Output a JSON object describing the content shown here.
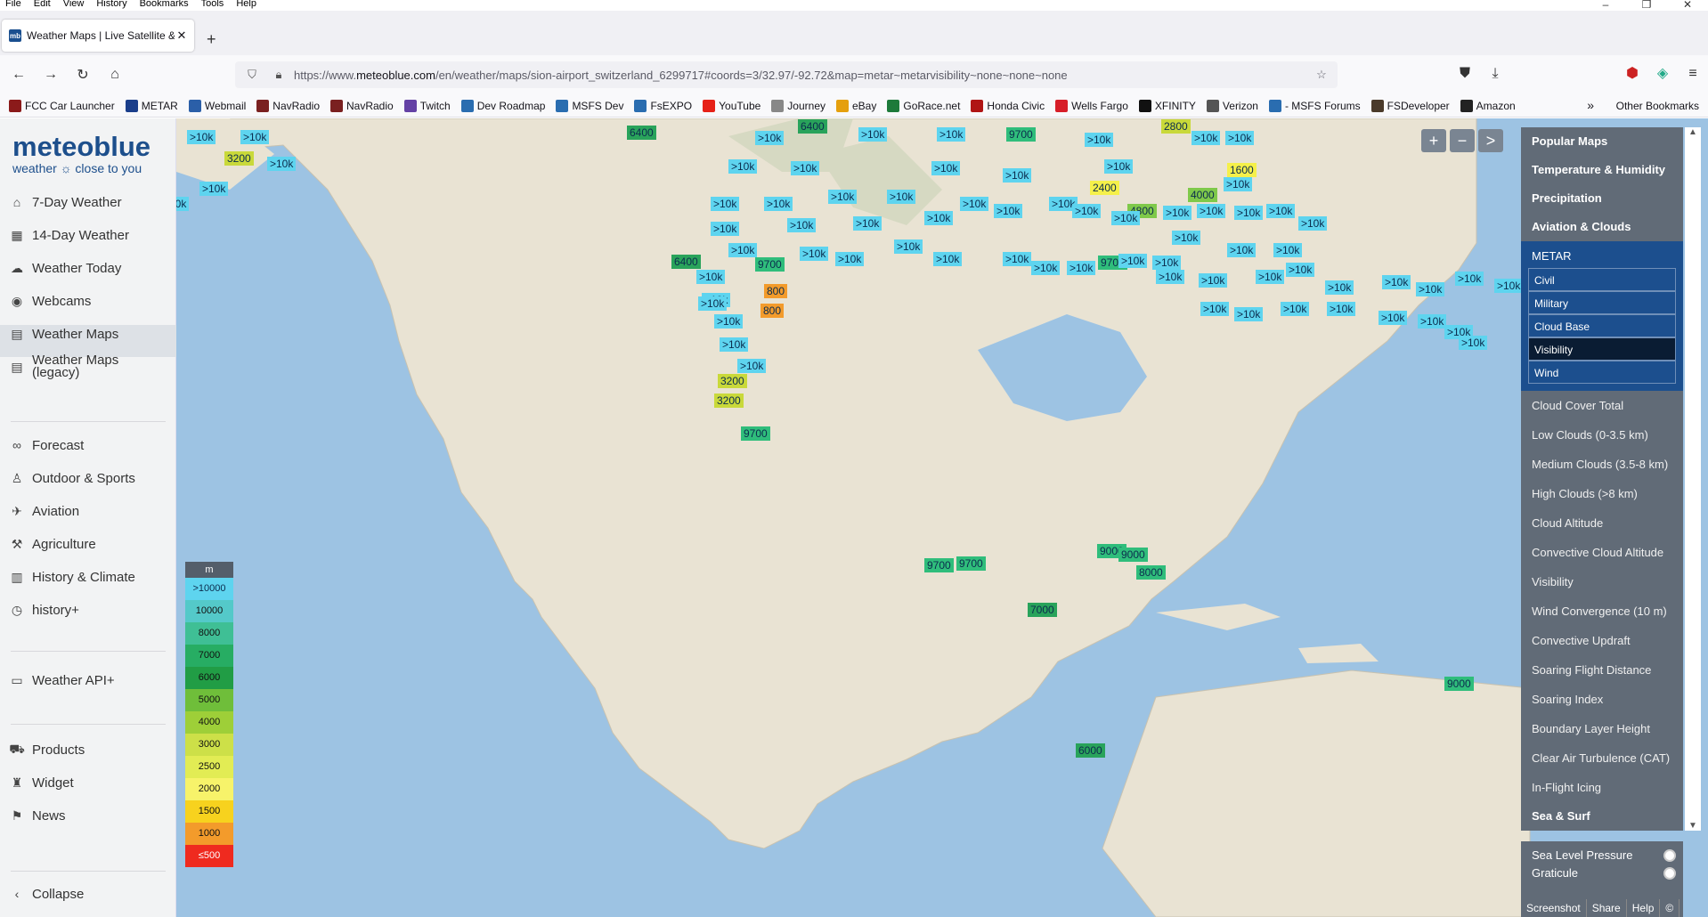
{
  "menubar": {
    "items": [
      "File",
      "Edit",
      "View",
      "History",
      "Bookmarks",
      "Tools",
      "Help"
    ]
  },
  "tab": {
    "title": "Weather Maps | Live Satellite &",
    "favicon": "mb"
  },
  "nav": {
    "url_prefix": "https://www.",
    "url_domain": "meteoblue.com",
    "url_rest": "/en/weather/maps/sion-airport_switzerland_6299717#coords=3/32.97/-92.72&map=metar~metarvisibility~none~none~none"
  },
  "bookmarks": {
    "items": [
      {
        "label": "FCC Car Launcher",
        "color": "#8b1a1a"
      },
      {
        "label": "METAR",
        "color": "#1a3e8b"
      },
      {
        "label": "Webmail",
        "color": "#2b5fa8"
      },
      {
        "label": "NavRadio",
        "color": "#7a2020"
      },
      {
        "label": "NavRadio",
        "color": "#7a2020"
      },
      {
        "label": "Twitch",
        "color": "#6441a5"
      },
      {
        "label": "Dev Roadmap",
        "color": "#2a6db0"
      },
      {
        "label": "MSFS Dev",
        "color": "#2a6db0"
      },
      {
        "label": "FsEXPO",
        "color": "#2a6db0"
      },
      {
        "label": "YouTube",
        "color": "#e62117"
      },
      {
        "label": "Journey",
        "color": "#888888"
      },
      {
        "label": "eBay",
        "color": "#e5a00d"
      },
      {
        "label": "GoRace.net",
        "color": "#1d7a3a"
      },
      {
        "label": "Honda Civic",
        "color": "#b01515"
      },
      {
        "label": "Wells Fargo",
        "color": "#d71e28"
      },
      {
        "label": "XFINITY",
        "color": "#111111"
      },
      {
        "label": "Verizon",
        "color": "#555555"
      },
      {
        "label": "- MSFS Forums",
        "color": "#2a6db0"
      },
      {
        "label": "FSDeveloper",
        "color": "#4a3a2a"
      },
      {
        "label": "Amazon",
        "color": "#222222"
      }
    ],
    "other": "Other Bookmarks"
  },
  "logo": {
    "name": "meteoblue",
    "tagline": "weather ☼ close to you"
  },
  "sidebar": {
    "items": [
      {
        "label": "7-Day Weather",
        "icon": "home-icon"
      },
      {
        "label": "14-Day Weather",
        "icon": "calendar-icon"
      },
      {
        "label": "Weather Today",
        "icon": "weather-icon"
      },
      {
        "label": "Webcams",
        "icon": "webcam-icon"
      },
      {
        "label": "Weather Maps",
        "icon": "map-icon"
      },
      {
        "label": "Weather Maps (legacy)",
        "icon": "map-icon"
      },
      {
        "label": "Forecast",
        "icon": "binoculars-icon"
      },
      {
        "label": "Outdoor & Sports",
        "icon": "hiker-icon"
      },
      {
        "label": "Aviation",
        "icon": "plane-icon"
      },
      {
        "label": "Agriculture",
        "icon": "tractor-icon"
      },
      {
        "label": "History & Climate",
        "icon": "chart-icon"
      },
      {
        "label": "history+",
        "icon": "history-icon"
      },
      {
        "label": "Weather API+",
        "icon": "api-icon"
      },
      {
        "label": "Products",
        "icon": "cart-icon"
      },
      {
        "label": "Widget",
        "icon": "widget-icon"
      },
      {
        "label": "News",
        "icon": "megaphone-icon"
      }
    ],
    "collapse": "Collapse"
  },
  "map_controls": {
    "zoom_in": "+",
    "zoom_out": "−",
    "expand": ">"
  },
  "legend": {
    "unit": "m",
    "rows": [
      {
        "label": ">10000",
        "color": "#5ed4ef"
      },
      {
        "label": "10000",
        "color": "#54c9c9"
      },
      {
        "label": "8000",
        "color": "#3fbf95"
      },
      {
        "label": "7000",
        "color": "#27ad63"
      },
      {
        "label": "6000",
        "color": "#219d45"
      },
      {
        "label": "5000",
        "color": "#6fbe3a"
      },
      {
        "label": "4000",
        "color": "#9ecf38"
      },
      {
        "label": "3000",
        "color": "#cde048"
      },
      {
        "label": "2500",
        "color": "#e2ec54"
      },
      {
        "label": "2000",
        "color": "#f7f36a"
      },
      {
        "label": "1500",
        "color": "#f7d21e"
      },
      {
        "label": "1000",
        "color": "#f39b2b"
      },
      {
        "label": "≤500",
        "color": "#ef2a1f"
      }
    ]
  },
  "right_menu": {
    "sections_top": [
      "Popular Maps",
      "Temperature & Humidity",
      "Precipitation",
      "Aviation & Clouds"
    ],
    "metar": {
      "title": "METAR",
      "options": [
        "Civil",
        "Military",
        "Cloud Base",
        "Visibility",
        "Wind"
      ],
      "selected": "Visibility"
    },
    "subitems": [
      "Cloud Cover Total",
      "Low Clouds (0-3.5 km)",
      "Medium Clouds (3.5-8 km)",
      "High Clouds (>8 km)",
      "Cloud Altitude",
      "Convective Cloud Altitude",
      "Visibility",
      "Wind Convergence (10 m)",
      "Convective Updraft",
      "Soaring Flight Distance",
      "Soaring Index",
      "Boundary Layer Height",
      "Clear Air Turbulence (CAT)",
      "In-Flight Icing"
    ],
    "section_bottom": "Sea & Surf",
    "toggles": [
      "Sea Level Pressure",
      "Graticule"
    ],
    "footer": [
      "Screenshot",
      "Share",
      "Help",
      "©"
    ]
  },
  "markers": [
    {
      "t": ">10k",
      "c": ""
    },
    {
      "t": ">10k",
      "c": ""
    },
    {
      "t": "3200",
      "c": "y"
    },
    {
      "t": ">10k",
      "c": ""
    },
    {
      "t": ">10k",
      "c": ""
    },
    {
      "t": ">10k",
      "c": ""
    },
    {
      "t": "6400",
      "c": "dg"
    },
    {
      "t": "6400",
      "c": "dg"
    },
    {
      "t": "9700",
      "c": "g1"
    },
    {
      "t": "2800",
      "c": "y"
    },
    {
      "t": "1600",
      "c": "ye"
    },
    {
      "t": "2400",
      "c": "ye"
    },
    {
      "t": "4000",
      "c": "g2"
    },
    {
      "t": "4800",
      "c": "g2"
    },
    {
      "t": "6400",
      "c": "dg"
    },
    {
      "t": "9700",
      "c": "g1"
    },
    {
      "t": "9700",
      "c": "g1"
    },
    {
      "t": "800",
      "c": "o"
    },
    {
      "t": "800",
      "c": "o"
    },
    {
      "t": "3200",
      "c": "y"
    },
    {
      "t": "3200",
      "c": "y"
    },
    {
      "t": "9700",
      "c": "g1"
    },
    {
      "t": "9000",
      "c": "g1"
    },
    {
      "t": "9000",
      "c": "g1"
    },
    {
      "t": "8000",
      "c": "g1"
    },
    {
      "t": "9700",
      "c": "g1"
    },
    {
      "t": "9700",
      "c": "g1"
    },
    {
      "t": "7000",
      "c": "dg"
    },
    {
      "t": "9000",
      "c": "g1"
    },
    {
      "t": "6000",
      "c": "dg"
    },
    {
      "t": ">10k",
      "c": ""
    },
    {
      "t": ">10k",
      "c": ""
    },
    {
      "t": ">10k",
      "c": ""
    },
    {
      "t": ">10k",
      "c": ""
    },
    {
      "t": ">10k",
      "c": ""
    },
    {
      "t": ">10k",
      "c": ""
    },
    {
      "t": ">10k",
      "c": ""
    },
    {
      "t": ">10k",
      "c": ""
    },
    {
      "t": ">10k",
      "c": ""
    },
    {
      "t": ">10k",
      "c": ""
    },
    {
      "t": ">10k",
      "c": ""
    },
    {
      "t": ">10k",
      "c": ""
    },
    {
      "t": ">10k",
      "c": ""
    },
    {
      "t": ">10k",
      "c": ""
    },
    {
      "t": ">10k",
      "c": ""
    },
    {
      "t": ">10k",
      "c": ""
    },
    {
      "t": ">10k",
      "c": ""
    },
    {
      "t": ">10k",
      "c": ""
    },
    {
      "t": ">10k",
      "c": ""
    },
    {
      "t": ">10k",
      "c": ""
    },
    {
      "t": ">10k",
      "c": ""
    },
    {
      "t": ">10k",
      "c": ""
    },
    {
      "t": ">10k",
      "c": ""
    },
    {
      "t": ">10k",
      "c": ""
    },
    {
      "t": ">10k",
      "c": ""
    },
    {
      "t": ">10k",
      "c": ""
    },
    {
      "t": ">10k",
      "c": ""
    },
    {
      "t": ">10k",
      "c": ""
    },
    {
      "t": ">10k",
      "c": ""
    },
    {
      "t": ">10k",
      "c": ""
    },
    {
      "t": ">10k",
      "c": ""
    },
    {
      "t": ">10k",
      "c": ""
    },
    {
      "t": ">10k",
      "c": ""
    },
    {
      "t": ">10k",
      "c": ""
    },
    {
      "t": ">10k",
      "c": ""
    },
    {
      "t": ">10k",
      "c": ""
    },
    {
      "t": ">10k",
      "c": ""
    },
    {
      "t": ">10k",
      "c": ""
    },
    {
      "t": ">10k",
      "c": ""
    },
    {
      "t": ">10k",
      "c": ""
    },
    {
      "t": ">10k",
      "c": ""
    },
    {
      "t": ">10k",
      "c": ""
    },
    {
      "t": ">10k",
      "c": ""
    },
    {
      "t": ">10k",
      "c": ""
    },
    {
      "t": ">10k",
      "c": ""
    },
    {
      "t": ">10k",
      "c": ""
    },
    {
      "t": ">10k",
      "c": ""
    },
    {
      "t": ">10k",
      "c": ""
    },
    {
      "t": ">10k",
      "c": ""
    },
    {
      "t": ">10k",
      "c": ""
    },
    {
      "t": ">10k",
      "c": ""
    },
    {
      "t": ">10k",
      "c": ""
    },
    {
      "t": ">10k",
      "c": ""
    },
    {
      "t": ">10k",
      "c": ""
    },
    {
      "t": ">10k",
      "c": ""
    },
    {
      "t": ">10k",
      "c": ""
    },
    {
      "t": ">10k",
      "c": ""
    },
    {
      "t": ">10k",
      "c": ""
    },
    {
      "t": ">10k",
      "c": ""
    },
    {
      "t": ">10k",
      "c": ""
    },
    {
      "t": ">10k",
      "c": ""
    },
    {
      "t": ">10k",
      "c": ""
    },
    {
      "t": ">10k",
      "c": ""
    },
    {
      "t": ">10k",
      "c": ""
    },
    {
      "t": ">10k",
      "c": ""
    },
    {
      "t": ">10k",
      "c": ""
    }
  ]
}
